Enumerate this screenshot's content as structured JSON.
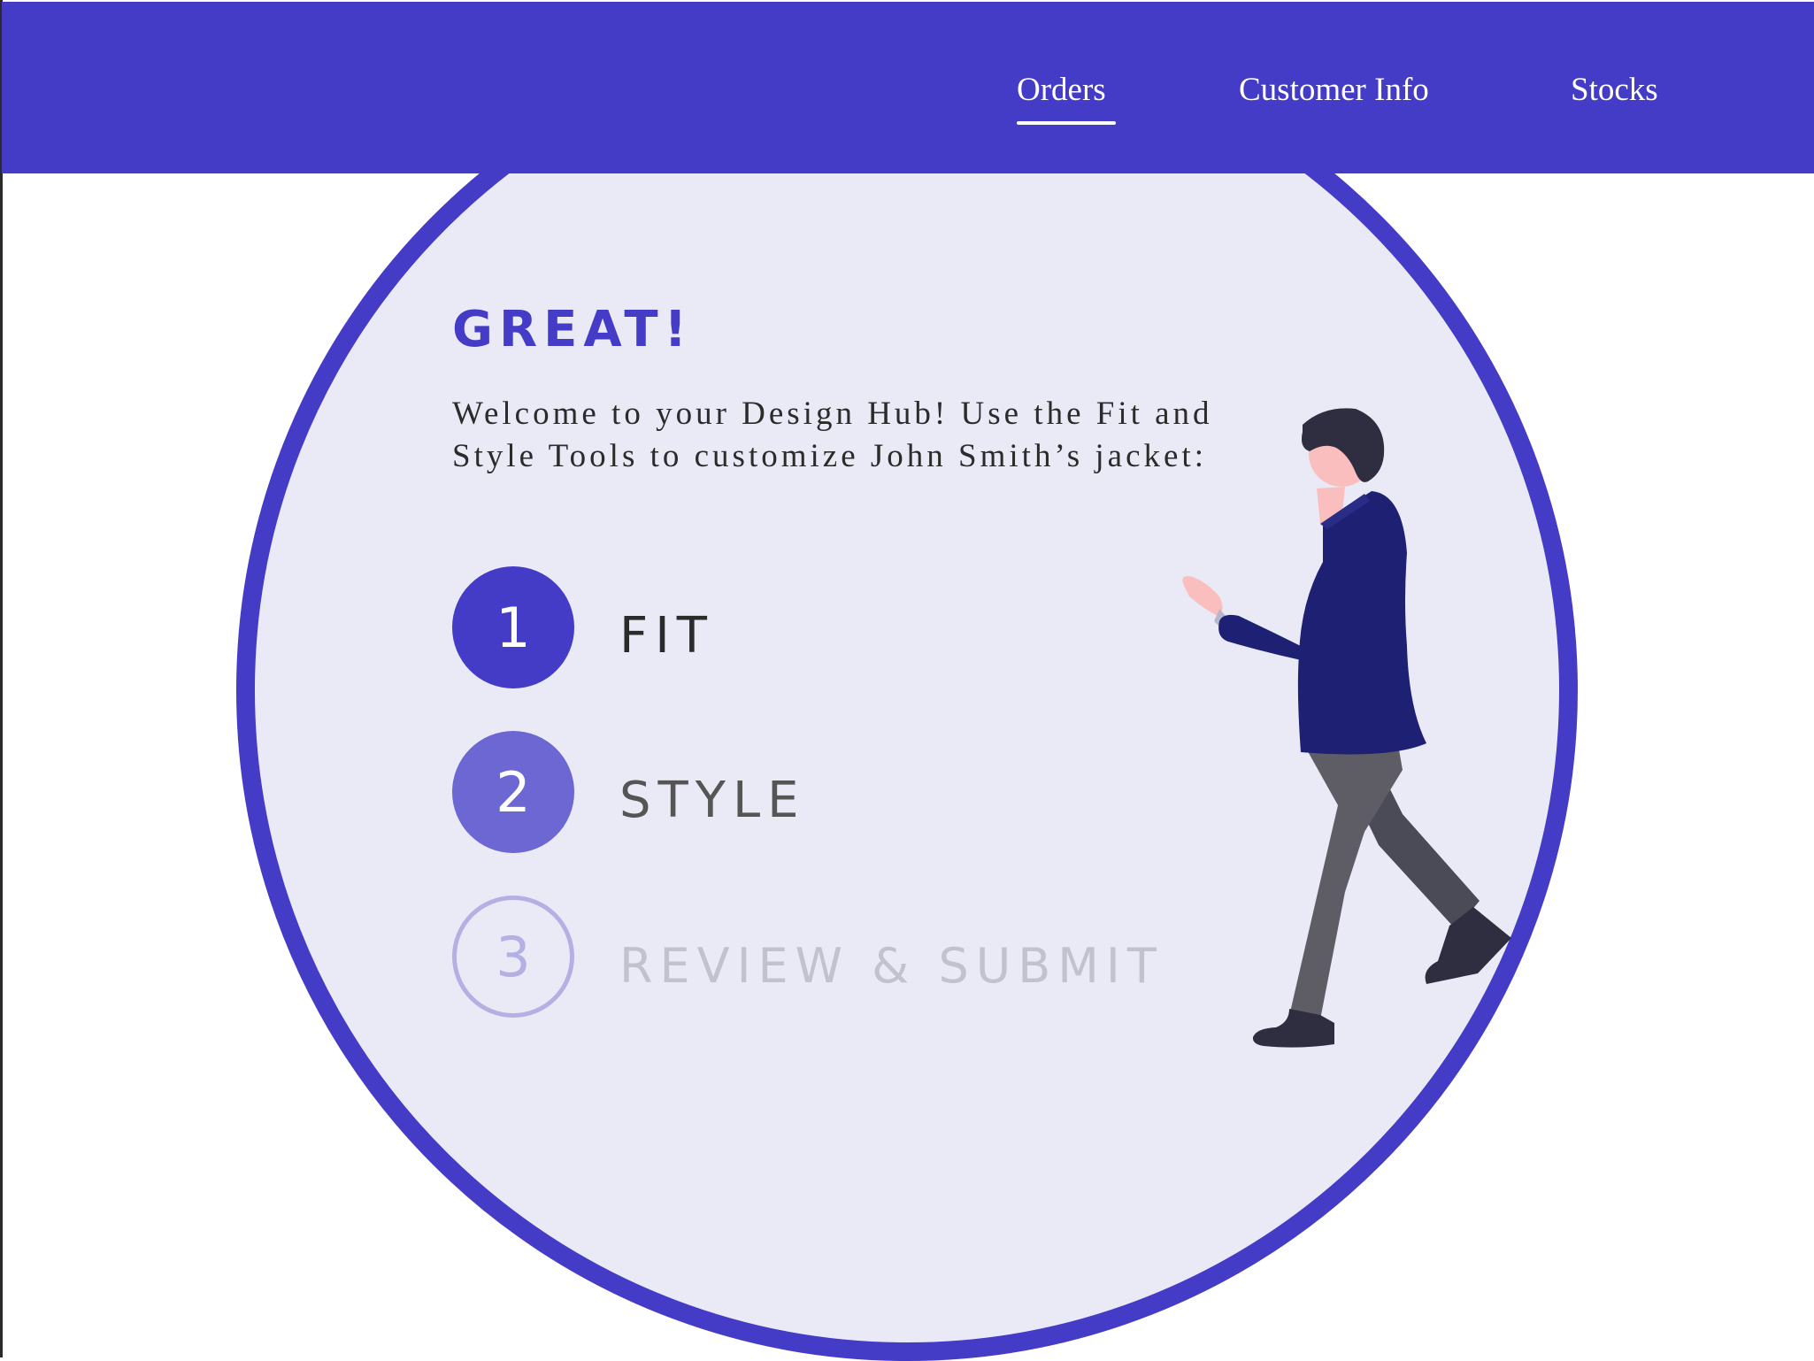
{
  "nav": {
    "items": [
      {
        "label": "Orders",
        "active": true
      },
      {
        "label": "Customer Info",
        "active": false
      },
      {
        "label": "Stocks",
        "active": false
      }
    ]
  },
  "hero": {
    "headline": "GREAT!",
    "welcome_text": "Welcome to your Design Hub! Use the Fit and Style Tools to customize John Smith’s jacket:"
  },
  "steps": [
    {
      "number": "1",
      "label": "FIT",
      "state": "active"
    },
    {
      "number": "2",
      "label": "STYLE",
      "state": "available"
    },
    {
      "number": "3",
      "label": "REVIEW & SUBMIT",
      "state": "disabled"
    }
  ],
  "illustration": {
    "icon": "walking-person-illustration"
  },
  "colors": {
    "primary": "#443bc7",
    "secondary": "#6c67d2",
    "disabled": "#b4b0e4",
    "circle_background": "#eaeaf7"
  }
}
